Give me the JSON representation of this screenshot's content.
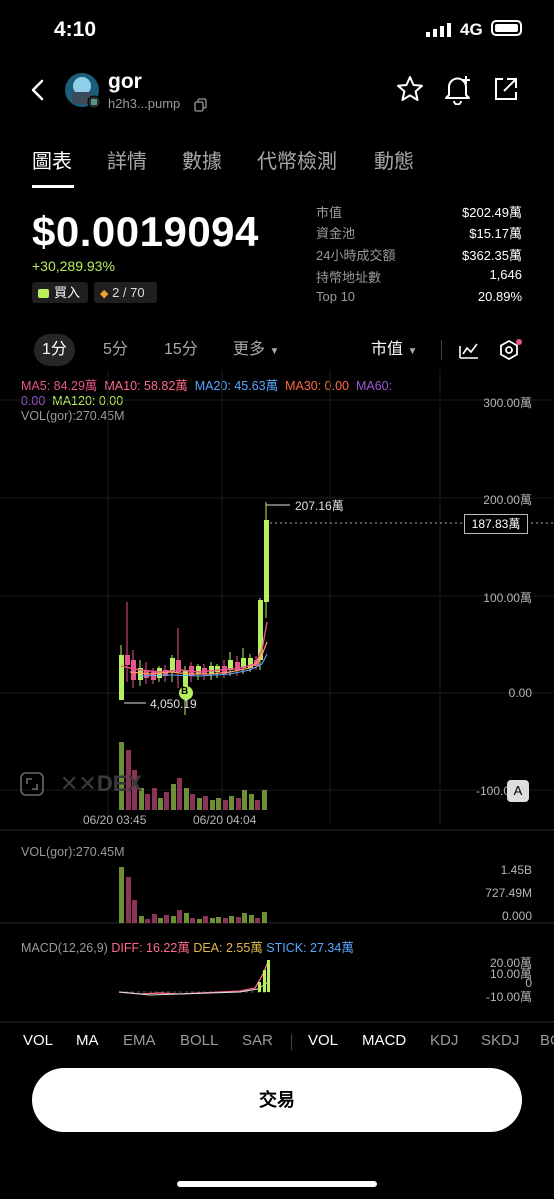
{
  "status": {
    "time": "4:10",
    "network": "4G"
  },
  "token": {
    "name": "gor",
    "address": "h2h3...pump"
  },
  "tabs": [
    "圖表",
    "詳情",
    "數據",
    "代幣檢測",
    "動態"
  ],
  "price": {
    "value": "$0.0019094",
    "change": "+30,289.93%",
    "buy_label": "買入",
    "rank": "2 / 70"
  },
  "stats": [
    {
      "k": "市值",
      "v": "$202.49萬"
    },
    {
      "k": "資金池",
      "v": "$15.17萬"
    },
    {
      "k": "24小時成交額",
      "v": "$362.35萬"
    },
    {
      "k": "持幣地址數",
      "v": "1,646"
    },
    {
      "k": "Top 10",
      "v": "20.89%"
    }
  ],
  "timeframes": [
    "1分",
    "5分",
    "15分",
    "更多"
  ],
  "mode": "市值",
  "ma": {
    "ma5": "MA5: 84.29萬",
    "ma10": "MA10: 58.82萬",
    "ma20": "MA20: 45.63萬",
    "ma30": "MA30: 0.00",
    "ma60": "MA60:",
    "ma60v": "0.00",
    "ma120": "MA120: 0.00",
    "vol": "VOL(gor):270.45M"
  },
  "main_axis": [
    "300.00萬",
    "200.00萬",
    "100.00萬",
    "0.00",
    "-100.0"
  ],
  "high_label": "207.16萬",
  "current_label": "187.83萬",
  "low_label": "4,050.19",
  "marker_b": "B",
  "dex_label": "DEX",
  "a_label": "A",
  "time_labels": [
    "06/20 03:45",
    "06/20 04:04"
  ],
  "vol_panel": {
    "title": "VOL(gor):270.45M",
    "axis": [
      "1.45B",
      "727.49M",
      "0.000"
    ]
  },
  "macd": {
    "title": "MACD(12,26,9)",
    "diff": "DIFF: 16.22萬",
    "dea": "DEA: 2.55萬",
    "stick": "STICK: 27.34萬",
    "axis": [
      "20.00萬",
      "10.00萬",
      "0",
      "-10.00萬"
    ]
  },
  "indicators_a": [
    "VOL",
    "MA",
    "EMA",
    "BOLL",
    "SAR"
  ],
  "indicators_b": [
    "VOL",
    "MACD",
    "KDJ",
    "SKDJ",
    "BO"
  ],
  "trade_label": "交易",
  "colors": {
    "up": "#b8ef5d",
    "down": "#e8548c",
    "ma5": "#e8548c",
    "ma10": "#ff6a8a",
    "ma20": "#5aa7ff",
    "ma30": "#ff6a3d",
    "ma60": "#9b59d0",
    "ma120": "#b8ef5d"
  }
}
